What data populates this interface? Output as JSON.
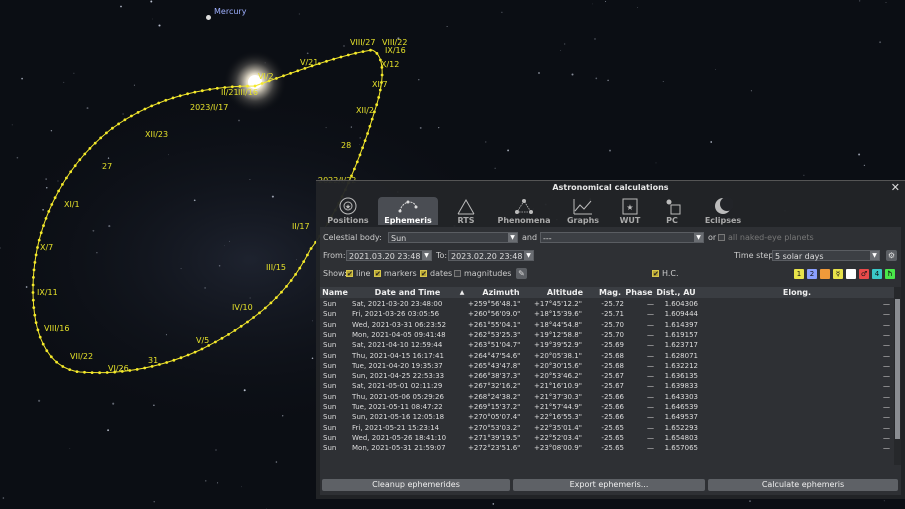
{
  "sky": {
    "planet_label": "Mercury",
    "path_labels": [
      "VIII/27",
      "VIII/22",
      "IX/16",
      "X/12",
      "XI/7",
      "XII/2",
      "28",
      "2022/I/22",
      "II/17",
      "III/15",
      "IV/10",
      "V/5",
      "31",
      "VI/26",
      "VII/22",
      "VIII/16",
      "IX/11",
      "X/7",
      "XI/1",
      "27",
      "XII/23",
      "2023/I/17",
      "II/21",
      "III/16",
      "V/21",
      "VI/2"
    ]
  },
  "dialog": {
    "title": "Astronomical calculations",
    "close_icon": "close-icon",
    "tabs": [
      {
        "label": "Positions",
        "icon": "positions-icon"
      },
      {
        "label": "Ephemeris",
        "icon": "ephemeris-icon"
      },
      {
        "label": "RTS",
        "icon": "rts-icon"
      },
      {
        "label": "Phenomena",
        "icon": "phenomena-icon"
      },
      {
        "label": "Graphs",
        "icon": "graphs-icon"
      },
      {
        "label": "WUT",
        "icon": "wut-icon"
      },
      {
        "label": "PC",
        "icon": "pc-icon"
      },
      {
        "label": "Eclipses",
        "icon": "eclipses-icon"
      }
    ],
    "active_tab": "Ephemeris",
    "celestial_body_label": "Celestial body:",
    "celestial_body_value": "Sun",
    "and_label": "and",
    "second_body_value": "---",
    "or_label": "or",
    "all_planets_label": "all naked-eye planets",
    "from_label": "From:",
    "from_value": "2021.03.20 23:48",
    "to_label": "To:",
    "to_value": "2023.02.20 23:48",
    "time_step_label": "Time step:",
    "time_step_value": "5 solar days",
    "show_label": "Show:",
    "line_label": "line",
    "markers_label": "markers",
    "dates_label": "dates",
    "magnitudes_label": "magnitudes",
    "hc_label": "H.C.",
    "color_buttons": [
      {
        "label": "1",
        "color": "#e8e34a"
      },
      {
        "label": "2",
        "color": "#8aa0ff"
      },
      {
        "label": "",
        "color": "#f09a3a"
      },
      {
        "label": "☿",
        "color": "#e8e34a"
      },
      {
        "label": "",
        "color": "#ffffff"
      },
      {
        "label": "♂",
        "color": "#e84a4a"
      },
      {
        "label": "4",
        "color": "#3ac8c8"
      },
      {
        "label": "ħ",
        "color": "#4ae84a"
      }
    ],
    "columns": [
      "Name",
      "Date and Time",
      "Azimuth",
      "Altitude",
      "Mag.",
      "Phase",
      "Dist., AU",
      "Elong."
    ],
    "rows": [
      [
        "Sun",
        "Sat, 2021-03-20 23:48:00",
        "+259°56'48.1\"",
        "+17°45'12.2\"",
        "-25.72",
        "—",
        "1.604306",
        "—"
      ],
      [
        "Sun",
        "Fri, 2021-03-26 03:05:56",
        "+260°56'09.0\"",
        "+18°15'39.6\"",
        "-25.71",
        "—",
        "1.609444",
        "—"
      ],
      [
        "Sun",
        "Wed, 2021-03-31 06:23:52",
        "+261°55'04.1\"",
        "+18°44'54.8\"",
        "-25.70",
        "—",
        "1.614397",
        "—"
      ],
      [
        "Sun",
        "Mon, 2021-04-05 09:41:48",
        "+262°53'25.3\"",
        "+19°12'58.8\"",
        "-25.70",
        "—",
        "1.619157",
        "—"
      ],
      [
        "Sun",
        "Sat, 2021-04-10 12:59:44",
        "+263°51'04.7\"",
        "+19°39'52.9\"",
        "-25.69",
        "—",
        "1.623717",
        "—"
      ],
      [
        "Sun",
        "Thu, 2021-04-15 16:17:41",
        "+264°47'54.6\"",
        "+20°05'38.1\"",
        "-25.68",
        "—",
        "1.628071",
        "—"
      ],
      [
        "Sun",
        "Tue, 2021-04-20 19:35:37",
        "+265°43'47.8\"",
        "+20°30'15.6\"",
        "-25.68",
        "—",
        "1.632212",
        "—"
      ],
      [
        "Sun",
        "Sun, 2021-04-25 22:53:33",
        "+266°38'37.3\"",
        "+20°53'46.2\"",
        "-25.67",
        "—",
        "1.636135",
        "—"
      ],
      [
        "Sun",
        "Sat, 2021-05-01 02:11:29",
        "+267°32'16.2\"",
        "+21°16'10.9\"",
        "-25.67",
        "—",
        "1.639833",
        "—"
      ],
      [
        "Sun",
        "Thu, 2021-05-06 05:29:26",
        "+268°24'38.2\"",
        "+21°37'30.3\"",
        "-25.66",
        "—",
        "1.643303",
        "—"
      ],
      [
        "Sun",
        "Tue, 2021-05-11 08:47:22",
        "+269°15'37.2\"",
        "+21°57'44.9\"",
        "-25.66",
        "—",
        "1.646539",
        "—"
      ],
      [
        "Sun",
        "Sun, 2021-05-16 12:05:18",
        "+270°05'07.4\"",
        "+22°16'55.3\"",
        "-25.66",
        "—",
        "1.649537",
        "—"
      ],
      [
        "Sun",
        "Fri, 2021-05-21 15:23:14",
        "+270°53'03.2\"",
        "+22°35'01.4\"",
        "-25.65",
        "—",
        "1.652293",
        "—"
      ],
      [
        "Sun",
        "Wed, 2021-05-26 18:41:10",
        "+271°39'19.5\"",
        "+22°52'03.4\"",
        "-25.65",
        "—",
        "1.654803",
        "—"
      ],
      [
        "Sun",
        "Mon, 2021-05-31 21:59:07",
        "+272°23'51.6\"",
        "+23°08'00.9\"",
        "-25.65",
        "—",
        "1.657065",
        "—"
      ]
    ],
    "buttons": {
      "cleanup": "Cleanup ephemerides",
      "export": "Export ephemeris...",
      "calculate": "Calculate ephemeris"
    }
  }
}
